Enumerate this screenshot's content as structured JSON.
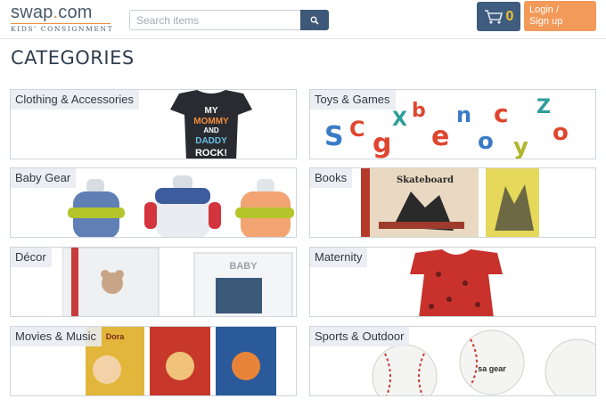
{
  "header": {
    "logo_text_main": "swap",
    "logo_text_dot": ".",
    "logo_text_tld": "com",
    "logo_tagline": "KIDS' CONSIGNMENT",
    "search_placeholder": "Search items",
    "search_icon": "search-icon",
    "cart_icon": "cart-icon",
    "cart_count": "0",
    "login_line1": "Login /",
    "login_line2": "Sign up",
    "colors": {
      "accent": "#f28c3b",
      "nav_blue": "#3f5c7e",
      "login_orange": "#f29a5a"
    }
  },
  "page": {
    "title": "CATEGORIES"
  },
  "categories": [
    {
      "label": "Clothing & Accessories",
      "image": "kids-tshirt",
      "shirt_text": [
        "MY",
        "MOMMY",
        "AND",
        "DADDY",
        "ROCK!"
      ]
    },
    {
      "label": "Toys & Games",
      "image": "foam-letters"
    },
    {
      "label": "Baby Gear",
      "image": "sippy-cups"
    },
    {
      "label": "Books",
      "image": "picture-books",
      "book_title": "Skateboard"
    },
    {
      "label": "Décor",
      "image": "picture-frames",
      "frame_text": "BABY"
    },
    {
      "label": "Maternity",
      "image": "red-floral-dress"
    },
    {
      "label": "Movies & Music",
      "image": "dvd-cases",
      "dvd_title": "Dora"
    },
    {
      "label": "Sports & Outdoor",
      "image": "baseballs",
      "ball_brand": "sa gear"
    }
  ]
}
